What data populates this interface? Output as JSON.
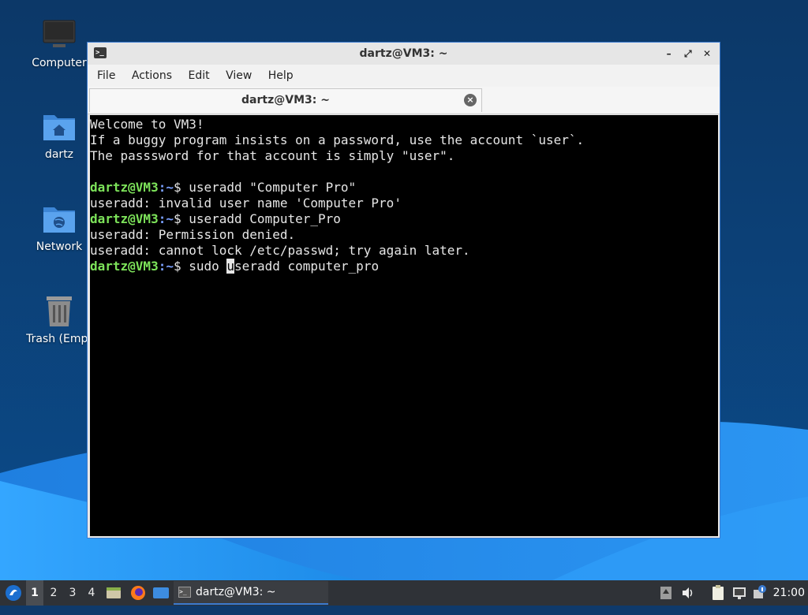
{
  "desktop": {
    "icons": [
      {
        "label": "Computer",
        "icon": "computer-icon"
      },
      {
        "label": "dartz",
        "icon": "home-folder-icon"
      },
      {
        "label": "Network",
        "icon": "network-folder-icon"
      },
      {
        "label": "Trash (Empt",
        "icon": "trash-icon"
      }
    ]
  },
  "window": {
    "title": "dartz@VM3: ~",
    "controls": {
      "minimize": "–",
      "maximize": "⤢",
      "close": "✕"
    },
    "menu": [
      "File",
      "Actions",
      "Edit",
      "View",
      "Help"
    ],
    "tab_title": "dartz@VM3: ~",
    "tab_close": "×"
  },
  "terminal": {
    "prompt_user": "dartz@VM3",
    "prompt_path": ":~",
    "prompt_symbol": "$ ",
    "lines": [
      {
        "text": "Welcome to VM3!"
      },
      {
        "text": "If a buggy program insists on a password, use the account `user`."
      },
      {
        "text": "The passsword for that account is simply \"user\"."
      },
      {
        "text": ""
      },
      {
        "prompt": true,
        "cmd": "useradd \"Computer Pro\""
      },
      {
        "text": "useradd: invalid user name 'Computer Pro'"
      },
      {
        "prompt": true,
        "cmd": "useradd Computer_Pro"
      },
      {
        "text": "useradd: Permission denied."
      },
      {
        "text": "useradd: cannot lock /etc/passwd; try again later."
      },
      {
        "prompt": true,
        "cmd_before_cursor": "sudo ",
        "cursor_char": "u",
        "cmd_after_cursor": "seradd computer_pro"
      }
    ]
  },
  "taskbar": {
    "workspaces": [
      "1",
      "2",
      "3",
      "4"
    ],
    "active_workspace": "1",
    "task_label": "dartz@VM3: ~",
    "clock": "21:00"
  },
  "colors": {
    "prompt_user": "#7de35a",
    "prompt_path": "#7aa0ff",
    "accent": "#3b7bd0"
  }
}
